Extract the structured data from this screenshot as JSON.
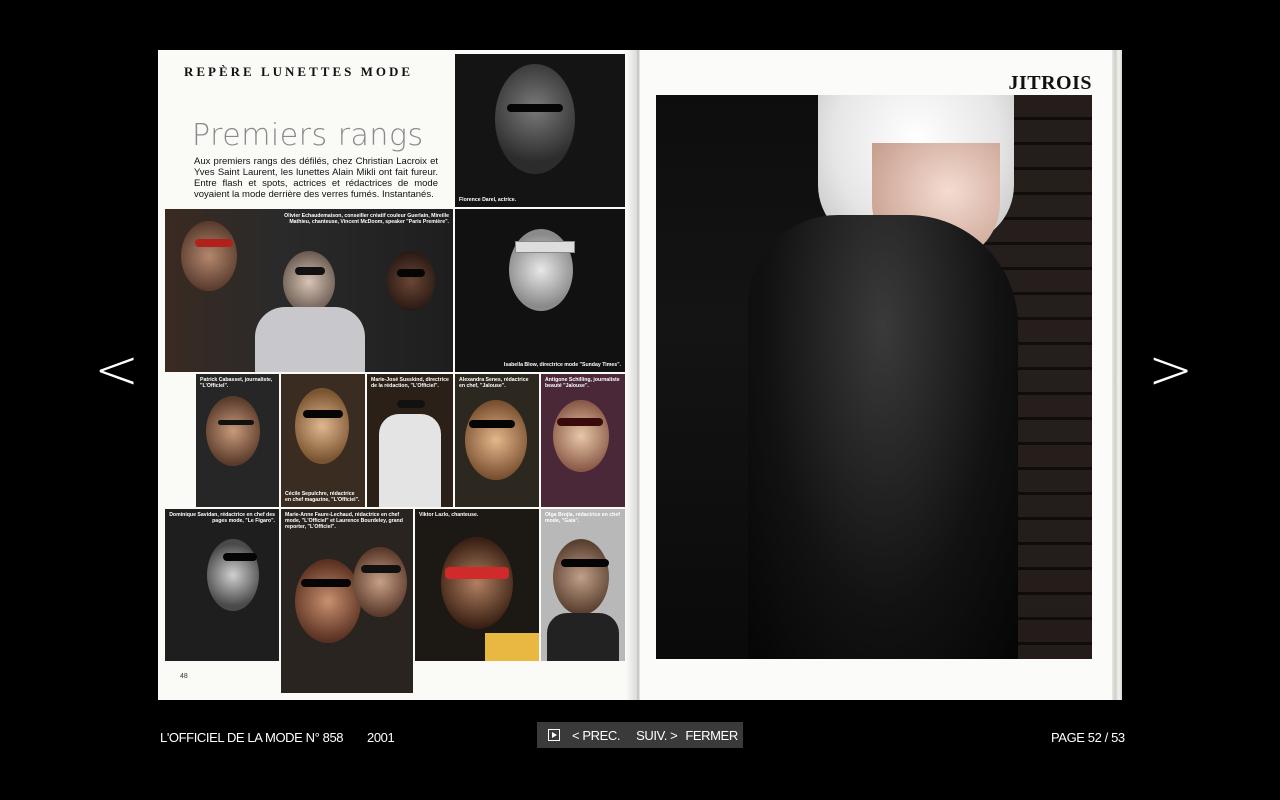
{
  "navigation": {
    "prev_arrow": "<",
    "next_arrow": ">"
  },
  "left_page": {
    "rubric": "REPÈRE LUNETTES MODE",
    "headline": "Premiers rangs",
    "intro": "Aux premiers rangs des défilés, chez Christian Lacroix et Yves Saint Laurent, les lunettes Alain Mikli ont fait fureur. Entre flash et spots, actrices et rédactrices de mode voyaient la mode derrière des verres fumés. Instantanés.",
    "page_number": "48",
    "captions": {
      "top_right": "Florence Darel, actrice.",
      "group": "Olivier Echaudemaison, conseiller créatif couleur Guerlain, Mireille Mathieu, chanteuse, Vincent McDoom, speaker \"Paris Première\".",
      "isabella": "Isabella Blow, directrice mode \"Sunday Times\".",
      "patrick": "Patrick Cabasset, journaliste, \"L'Officiel\".",
      "cecile": "Cécile Sepulchre, rédactrice en chef magazine, \"L'Officiel\".",
      "mariejose": "Marie-José Susskind, directrice de la rédaction, \"L'Officiel\".",
      "alexandra": "Alexandra Senes, rédactrice en chef, \"Jalouse\".",
      "antigone": "Antigone Schilling, journaliste beauté \"Jalouse\".",
      "dominique": "Dominique Savidan, rédactrice en chef des pages mode, \"Le Figaro\".",
      "marieanne": "Marie-Anne Faure-Lechaud, rédactrice en chef mode, \"L'Officiel\" et Laurence Bourdeley, grand reporter, \"L'Officiel\".",
      "viktor": "Viktor Lazlo, chanteuse.",
      "olga": "Olga Brojla, rédactrice en chef mode, \"Gala\"."
    }
  },
  "right_page": {
    "brand": "JITROIS"
  },
  "bottom_bar": {
    "publication": "L'OFFICIEL DE LA MODE N° 858",
    "year": "2001",
    "prev_label": "< PREC.",
    "next_label": "SUIV. >",
    "close_label": "FERMER",
    "page_indicator": "PAGE 52 / 53"
  },
  "colors": {
    "background": "#000000",
    "paper": "#fafaf7",
    "control_bg": "#3a3a3a",
    "headline_gray": "#8a8a8a"
  }
}
